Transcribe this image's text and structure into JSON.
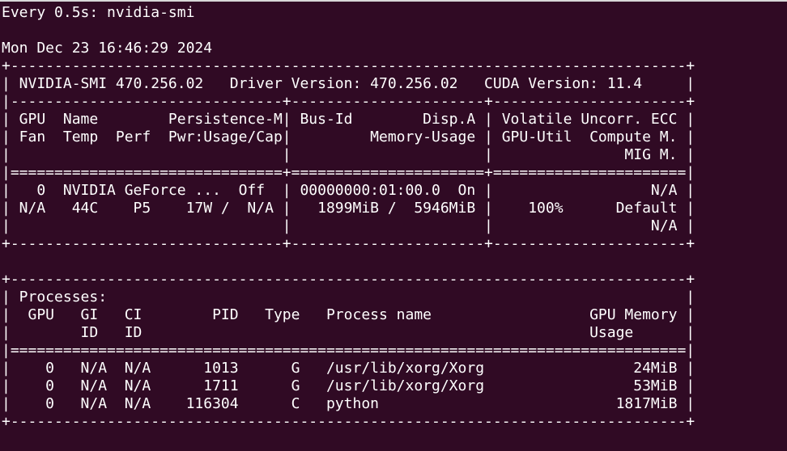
{
  "terminal": {
    "lines": [
      "Every 0.5s: nvidia-smi",
      "",
      "Mon Dec 23 16:46:29 2024",
      "+-----------------------------------------------------------------------------+",
      "| NVIDIA-SMI 470.256.02   Driver Version: 470.256.02   CUDA Version: 11.4     |",
      "|-------------------------------+----------------------+----------------------+",
      "| GPU  Name        Persistence-M| Bus-Id        Disp.A | Volatile Uncorr. ECC |",
      "| Fan  Temp  Perf  Pwr:Usage/Cap|         Memory-Usage | GPU-Util  Compute M. |",
      "|                               |                      |               MIG M. |",
      "|===============================+======================+======================|",
      "|   0  NVIDIA GeForce ...  Off  | 00000000:01:00.0  On |                  N/A |",
      "| N/A   44C    P5    17W /  N/A |   1899MiB /  5946MiB |    100%      Default |",
      "|                               |                      |                  N/A |",
      "+-------------------------------+----------------------+----------------------+",
      "",
      "+-----------------------------------------------------------------------------+",
      "| Processes:                                                                  |",
      "|  GPU   GI   CI        PID   Type   Process name                  GPU Memory |",
      "|        ID   ID                                                   Usage      |",
      "|=============================================================================|",
      "|    0   N/A  N/A      1013      G   /usr/lib/xorg/Xorg                 24MiB |",
      "|    0   N/A  N/A      1711      G   /usr/lib/xorg/Xorg                 53MiB |",
      "|    0   N/A  N/A    116304      C   python                           1817MiB |",
      "+-----------------------------------------------------------------------------+"
    ]
  },
  "colors": {
    "background": "#300a24",
    "foreground": "#ffffff"
  }
}
